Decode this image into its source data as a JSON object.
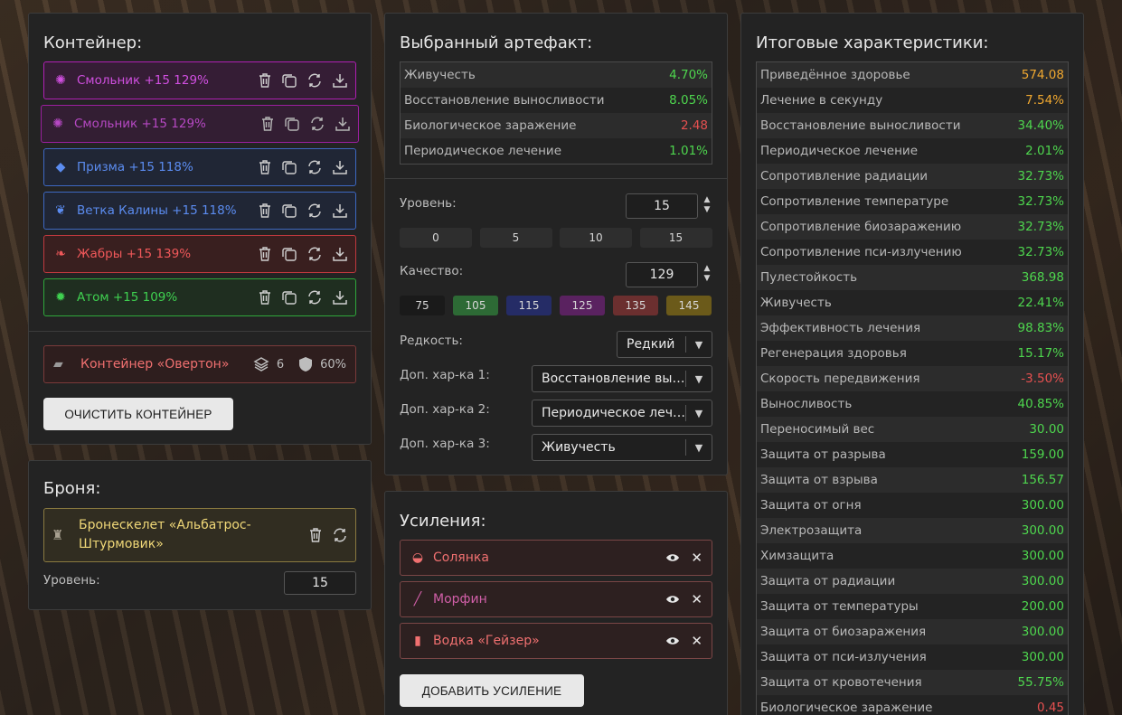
{
  "container": {
    "title": "Контейнер:",
    "artefacts": [
      {
        "name": "Смольник +15 129%",
        "color": "purple",
        "icon": "tar-icon",
        "glyph": "✺"
      },
      {
        "name": "Смольник +15 129%",
        "color": "purple",
        "icon": "tar-icon",
        "glyph": "✺"
      },
      {
        "name": "Призма +15 118%",
        "color": "blue",
        "icon": "prism-icon",
        "glyph": "◆"
      },
      {
        "name": "Ветка Калины +15 118%",
        "color": "blue",
        "icon": "branch-icon",
        "glyph": "❦"
      },
      {
        "name": "Жабры +15 139%",
        "color": "red",
        "icon": "gills-icon",
        "glyph": "❧"
      },
      {
        "name": "Атом +15 109%",
        "color": "green",
        "icon": "atom-icon",
        "glyph": "✹"
      }
    ],
    "container_item": {
      "name": "Контейнер «Овертон»",
      "slots": "6",
      "protection": "60%"
    },
    "clear_button": "ОЧИСТИТЬ КОНТЕЙНЕР"
  },
  "armor": {
    "title": "Броня:",
    "name_line1": "Бронескелет «Альбатрос-",
    "name_line2": "Штурмовик»",
    "level_label": "Уровень:",
    "level_value": "15"
  },
  "selected": {
    "title": "Выбранный артефакт:",
    "stats": [
      {
        "label": "Живучесть",
        "value": "4.70%",
        "tone": "green"
      },
      {
        "label": "Восстановление выносливости",
        "value": "8.05%",
        "tone": "green"
      },
      {
        "label": "Биологическое заражение",
        "value": "2.48",
        "tone": "red"
      },
      {
        "label": "Периодическое лечение",
        "value": "1.01%",
        "tone": "green"
      }
    ],
    "level_label": "Уровень:",
    "level_value": "15",
    "level_presets": [
      "0",
      "5",
      "10",
      "15"
    ],
    "quality_label": "Качество:",
    "quality_value": "129",
    "quality_presets": [
      {
        "label": "75",
        "color": "#1a1a1a"
      },
      {
        "label": "105",
        "color": "#2d6a35"
      },
      {
        "label": "115",
        "color": "#252c66"
      },
      {
        "label": "125",
        "color": "#5a2260"
      },
      {
        "label": "135",
        "color": "#6b2f2f"
      },
      {
        "label": "145",
        "color": "#6b5a1a"
      }
    ],
    "rarity_label": "Редкость:",
    "rarity_value": "Редкий",
    "extra1_label": "Доп. хар-ка 1:",
    "extra1_value": "Восстановление выносливости",
    "extra2_label": "Доп. хар-ка 2:",
    "extra2_value": "Периодическое лечение",
    "extra3_label": "Доп. хар-ка 3:",
    "extra3_value": "Живучесть"
  },
  "boosts": {
    "title": "Усиления:",
    "items": [
      {
        "name": "Солянка",
        "color": "#f07070",
        "icon": "soup-icon",
        "glyph": "◒"
      },
      {
        "name": "Морфин",
        "color": "#d15fa8",
        "icon": "syringe-icon",
        "glyph": "╱"
      },
      {
        "name": "Водка «Гейзер»",
        "color": "#f07070",
        "icon": "bottle-icon",
        "glyph": "▮"
      }
    ],
    "add_button": "ДОБАВИТЬ УСИЛЕНИЕ"
  },
  "totals": {
    "title": "Итоговые характеристики:",
    "rows": [
      {
        "label": "Приведённое здоровье",
        "value": "574.08",
        "tone": "orange"
      },
      {
        "label": "Лечение в секунду",
        "value": "7.54%",
        "tone": "orange"
      },
      {
        "label": "Восстановление выносливости",
        "value": "34.40%",
        "tone": "green"
      },
      {
        "label": "Периодическое лечение",
        "value": "2.01%",
        "tone": "green"
      },
      {
        "label": "Сопротивление радиации",
        "value": "32.73%",
        "tone": "green"
      },
      {
        "label": "Сопротивление температуре",
        "value": "32.73%",
        "tone": "green"
      },
      {
        "label": "Сопротивление биозаражению",
        "value": "32.73%",
        "tone": "green"
      },
      {
        "label": "Сопротивление пси-излучению",
        "value": "32.73%",
        "tone": "green"
      },
      {
        "label": "Пулестойкость",
        "value": "368.98",
        "tone": "green"
      },
      {
        "label": "Живучесть",
        "value": "22.41%",
        "tone": "green"
      },
      {
        "label": "Эффективность лечения",
        "value": "98.83%",
        "tone": "green"
      },
      {
        "label": "Регенерация здоровья",
        "value": "15.17%",
        "tone": "green"
      },
      {
        "label": "Скорость передвижения",
        "value": "-3.50%",
        "tone": "red"
      },
      {
        "label": "Выносливость",
        "value": "40.85%",
        "tone": "green"
      },
      {
        "label": "Переносимый вес",
        "value": "30.00",
        "tone": "green"
      },
      {
        "label": "Защита от разрыва",
        "value": "159.00",
        "tone": "green"
      },
      {
        "label": "Защита от взрыва",
        "value": "156.57",
        "tone": "green"
      },
      {
        "label": "Защита от огня",
        "value": "300.00",
        "tone": "green"
      },
      {
        "label": "Электрозащита",
        "value": "300.00",
        "tone": "green"
      },
      {
        "label": "Химзащита",
        "value": "300.00",
        "tone": "green"
      },
      {
        "label": "Защита от радиации",
        "value": "300.00",
        "tone": "green"
      },
      {
        "label": "Защита от температуры",
        "value": "200.00",
        "tone": "green"
      },
      {
        "label": "Защита от биозаражения",
        "value": "300.00",
        "tone": "green"
      },
      {
        "label": "Защита от пси-излучения",
        "value": "300.00",
        "tone": "green"
      },
      {
        "label": "Защита от кровотечения",
        "value": "55.75%",
        "tone": "green"
      },
      {
        "label": "Биологическое заражение",
        "value": "0.45",
        "tone": "red"
      }
    ]
  }
}
